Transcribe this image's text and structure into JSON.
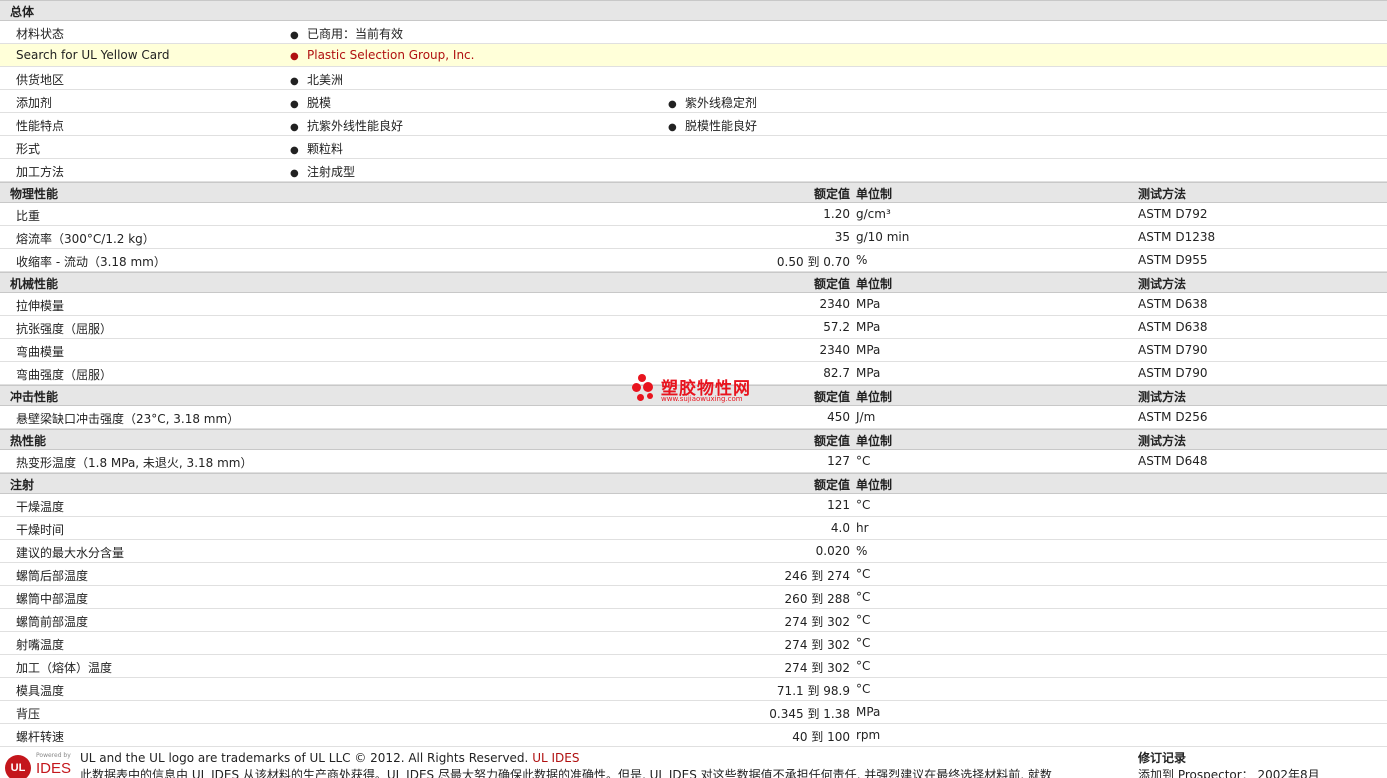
{
  "header_labels": {
    "value": "额定值",
    "unit": "单位制",
    "test": "测试方法"
  },
  "general": {
    "title": "总体",
    "rows": [
      {
        "label": "材料状态",
        "b1": "已商用：当前有效",
        "b2": ""
      },
      {
        "label": "Search for UL Yellow Card",
        "b1": "Plastic Selection Group, Inc.",
        "b2": ""
      },
      {
        "label": "供货地区",
        "b1": "北美洲",
        "b2": ""
      },
      {
        "label": "添加剂",
        "b1": "脱模",
        "b2": "紫外线稳定剂"
      },
      {
        "label": "性能特点",
        "b1": "抗紫外线性能良好",
        "b2": "脱模性能良好"
      },
      {
        "label": "形式",
        "b1": "颗粒料",
        "b2": ""
      },
      {
        "label": "加工方法",
        "b1": "注射成型",
        "b2": ""
      }
    ]
  },
  "physical": {
    "title": "物理性能",
    "rows": [
      {
        "label": "比重",
        "value": "1.20",
        "unit": "g/cm³",
        "test": "ASTM D792"
      },
      {
        "label": "熔流率（300°C/1.2 kg）",
        "value": "35",
        "unit": "g/10 min",
        "test": "ASTM D1238"
      },
      {
        "label": "收缩率 - 流动（3.18 mm）",
        "value": "0.50 到  0.70",
        "unit": "%",
        "test": "ASTM D955"
      }
    ]
  },
  "mechanical": {
    "title": "机械性能",
    "rows": [
      {
        "label": "拉伸模量",
        "value": "2340",
        "unit": "MPa",
        "test": "ASTM D638"
      },
      {
        "label": "抗张强度（屈服）",
        "value": "57.2",
        "unit": "MPa",
        "test": "ASTM D638"
      },
      {
        "label": "弯曲模量",
        "value": "2340",
        "unit": "MPa",
        "test": "ASTM D790"
      },
      {
        "label": "弯曲强度（屈服）",
        "value": "82.7",
        "unit": "MPa",
        "test": "ASTM D790"
      }
    ]
  },
  "impact": {
    "title": "冲击性能",
    "rows": [
      {
        "label": "悬壁梁缺口冲击强度（23°C, 3.18 mm）",
        "value": "450",
        "unit": "J/m",
        "test": "ASTM D256"
      }
    ]
  },
  "thermal": {
    "title": "热性能",
    "rows": [
      {
        "label": "热变形温度（1.8 MPa, 未退火, 3.18 mm）",
        "value": "127",
        "unit": "°C",
        "test": "ASTM D648"
      }
    ]
  },
  "injection": {
    "title": "注射",
    "rows": [
      {
        "label": "干燥温度",
        "value": "121",
        "unit": "°C"
      },
      {
        "label": "干燥时间",
        "value": "4.0",
        "unit": "hr"
      },
      {
        "label": "建议的最大水分含量",
        "value": "0.020",
        "unit": "%"
      },
      {
        "label": "螺筒后部温度",
        "value": "246 到  274",
        "unit": "°C"
      },
      {
        "label": "螺筒中部温度",
        "value": "260 到  288",
        "unit": "°C"
      },
      {
        "label": "螺筒前部温度",
        "value": "274 到  302",
        "unit": "°C"
      },
      {
        "label": "射嘴温度",
        "value": "274 到  302",
        "unit": "°C"
      },
      {
        "label": "加工（熔体）温度",
        "value": "274 到  302",
        "unit": "°C"
      },
      {
        "label": "模具温度",
        "value": "71.1 到  98.9",
        "unit": "°C"
      },
      {
        "label": "背压",
        "value": "0.345 到  1.38",
        "unit": "MPa"
      },
      {
        "label": "螺杆转速",
        "value": "40 到  100",
        "unit": "rpm"
      }
    ]
  },
  "watermark": {
    "cn": "塑胶物性网",
    "url": "www.sujiaowuxing.com"
  },
  "footer": {
    "logo_mark": "UL",
    "logo_powered": "Powered by",
    "logo_text": "IDES",
    "trademark": "UL and the UL logo are trademarks of UL LLC © 2012. All Rights Reserved.",
    "trademark_link": "UL IDES",
    "disclaimer": "此数据表中的信息由 UL IDES 从该材料的生产商处获得。UL IDES 尽最大努力确保此数据的准确性。但是, UL IDES 对这些数据值不承担任何责任, 并强烈建议在最终选择材料前, 就数",
    "revision_title": "修订记录",
    "revision_text": "添加到 Prospector：   2002年8月"
  }
}
